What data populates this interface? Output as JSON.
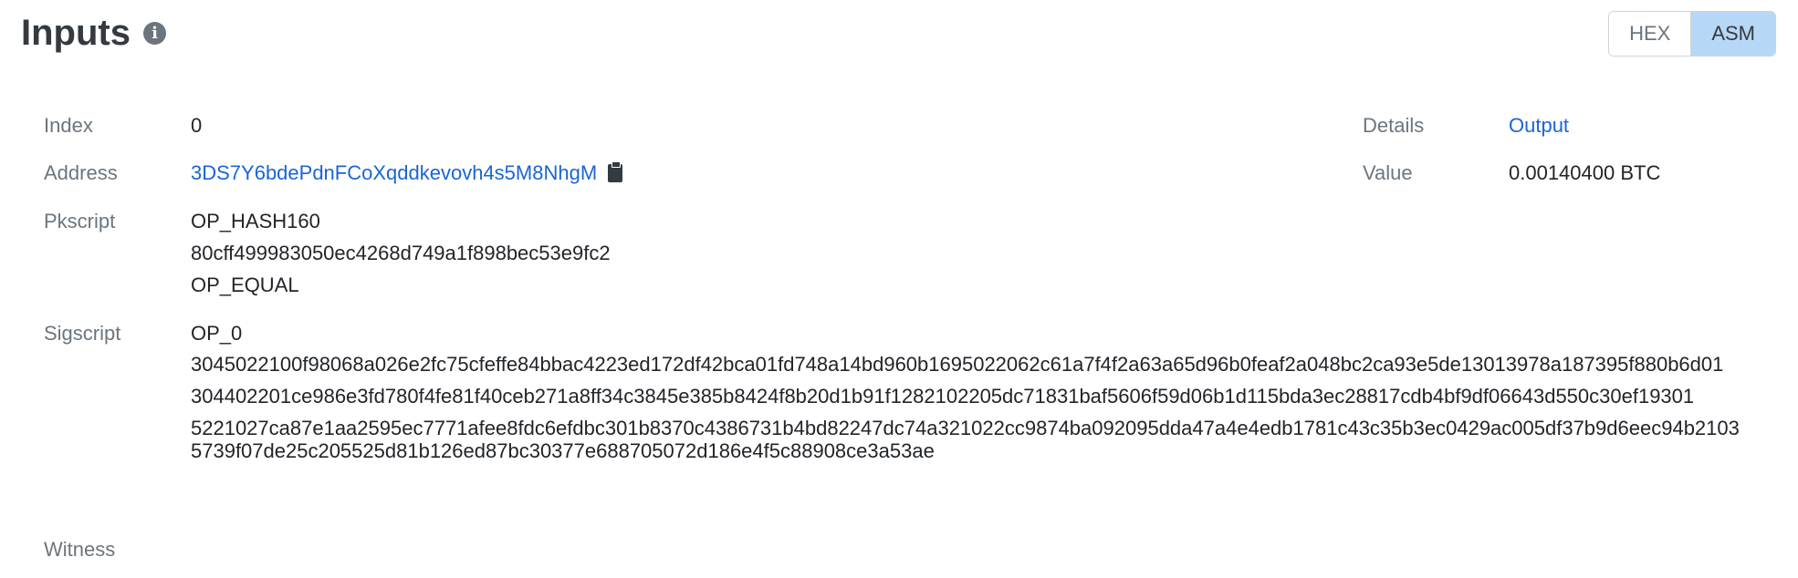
{
  "header": {
    "title": "Inputs",
    "info_icon": "info-icon",
    "toggle": {
      "hex_label": "HEX",
      "asm_label": "ASM",
      "active": "ASM"
    }
  },
  "input": {
    "index": {
      "label": "Index",
      "value": "0"
    },
    "address": {
      "label": "Address",
      "value": "3DS7Y6bdePdnFCoXqddkevovh4s5M8NhgM",
      "copy_icon": "clipboard-icon"
    },
    "pkscript": {
      "label": "Pkscript",
      "lines": [
        "OP_HASH160",
        "80cff499983050ec4268d749a1f898bec53e9fc2",
        "OP_EQUAL"
      ]
    },
    "sigscript": {
      "label": "Sigscript",
      "lines": [
        "OP_0",
        "3045022100f98068a026e2fc75cfeffe84bbac4223ed172df42bca01fd748a14bd960b1695022062c61a7f4f2a63a65d96b0feaf2a048bc2ca93e5de13013978a187395f880b6d01",
        "304402201ce986e3fd780f4fe81f40ceb271a8ff34c3845e385b8424f8b20d1b91f1282102205dc71831baf5606f59d06b1d115bda3ec28817cdb4bf9df06643d550c30ef19301",
        "5221027ca87e1aa2595ec7771afee8fdc6efdbc301b8370c4386731b4bd82247dc74a321022cc9874ba092095dda47a4e4edb1781c43c35b3ec0429ac005df37b9d6eec94b21035739f07de25c205525d81b126ed87bc30377e688705072d186e4f5c88908ce3a53ae"
      ]
    },
    "witness": {
      "label": "Witness"
    },
    "details": {
      "label": "Details",
      "value": "Output"
    },
    "value": {
      "label": "Value",
      "value": "0.00140400 BTC"
    }
  }
}
